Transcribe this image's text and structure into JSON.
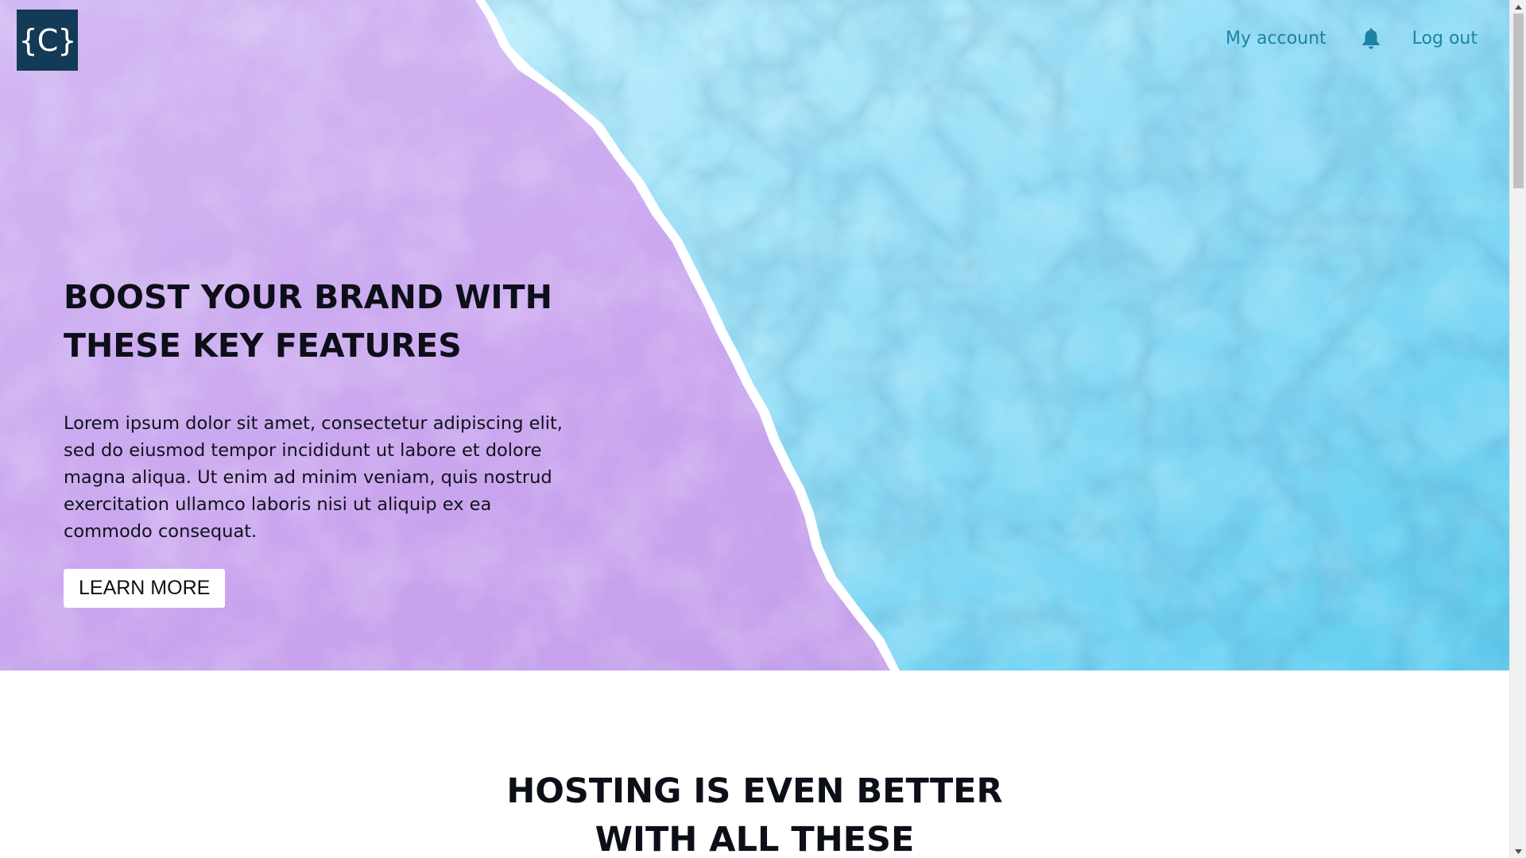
{
  "header": {
    "logo_text": "{C}",
    "nav": {
      "my_account": "My account",
      "bell_icon": "bell-icon",
      "log_out": "Log out"
    }
  },
  "hero": {
    "title_line1": "BOOST YOUR BRAND WITH",
    "title_line2": "THESE KEY FEATURES",
    "text": "Lorem ipsum dolor sit amet, consectetur adipiscing elit, sed do eiusmod tempor incididunt ut labore et dolore magna aliqua. Ut enim ad minim veniam, quis nostrud exercitation ullamco laboris nisi ut aliquip ex ea commodo consequat.",
    "button_label": "LEARN MORE"
  },
  "section2": {
    "title_line1": "HOSTING IS EVEN BETTER",
    "title_line2": "WITH ALL THESE"
  },
  "colors": {
    "logo_bg": "#133a56",
    "nav_link": "#1d82a6",
    "hero_left": "#c9a6ef",
    "hero_right": "#8fdcf6",
    "text_dark": "#0c0f18"
  }
}
